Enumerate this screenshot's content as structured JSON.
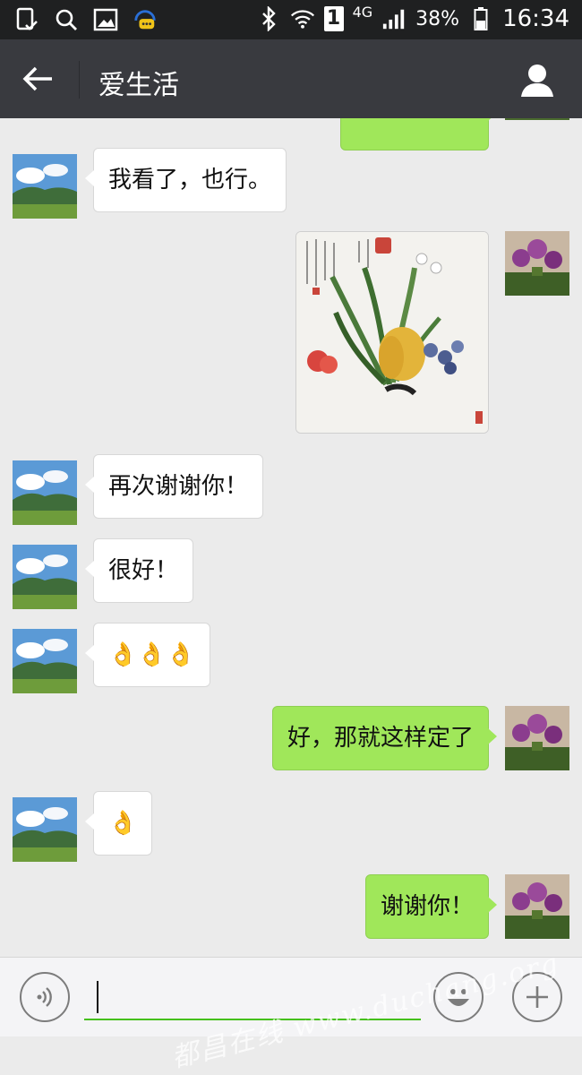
{
  "status_bar": {
    "network": "4G",
    "sim_slot": "1",
    "battery_percent": "38%",
    "time": "16:34",
    "left_icons": [
      "phone-check-icon",
      "search-icon",
      "image-icon",
      "assistant-icon"
    ],
    "right_icons": [
      "bluetooth-icon",
      "wifi-icon",
      "signal-icon",
      "battery-icon"
    ]
  },
  "header": {
    "title": "爱生活",
    "back_icon": "arrow-left-icon",
    "profile_icon": "person-icon"
  },
  "messages": [
    {
      "side": "out",
      "type": "text",
      "text": ""
    },
    {
      "side": "in",
      "type": "text",
      "text": "我看了，也行。"
    },
    {
      "side": "out",
      "type": "image",
      "description": "painting"
    },
    {
      "side": "in",
      "type": "text",
      "text": "再次谢谢你！"
    },
    {
      "side": "in",
      "type": "text",
      "text": "很好！"
    },
    {
      "side": "in",
      "type": "emoji",
      "text": "👌👌👌"
    },
    {
      "side": "out",
      "type": "text",
      "text": "好，那就这样定了"
    },
    {
      "side": "in",
      "type": "emoji",
      "text": "👌"
    },
    {
      "side": "out",
      "type": "text",
      "text": "谢谢你！"
    }
  ],
  "input_bar": {
    "voice_icon": "voice-icon",
    "emoji_icon": "smile-icon",
    "more_icon": "plus-icon",
    "value": ""
  },
  "watermark": "都昌在线 www.duchang.org",
  "colors": {
    "status_bar": "#1f2021",
    "title_bar": "#393a3f",
    "chat_bg": "#ebebeb",
    "outgoing_bubble": "#a0e75a",
    "incoming_bubble": "#ffffff",
    "input_underline": "#45c01a"
  }
}
